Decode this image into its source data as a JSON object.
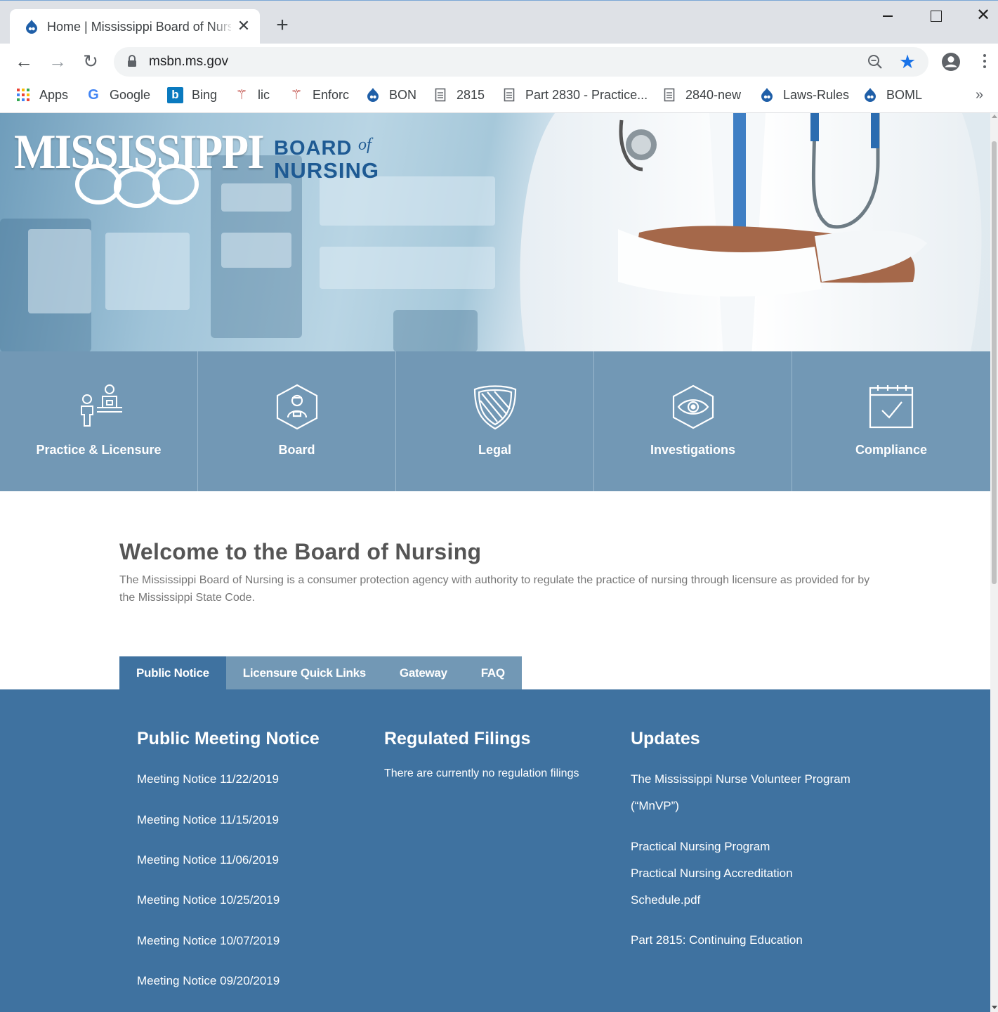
{
  "browser": {
    "tab_title": "Home | Mississippi Board of Nursing",
    "new_tab_label": "+",
    "url": "msbn.ms.gov",
    "bookmarks": [
      {
        "label": "Apps",
        "icon": "apps-grid-icon"
      },
      {
        "label": "Google",
        "icon": "google-icon"
      },
      {
        "label": "Bing",
        "icon": "bing-icon"
      },
      {
        "label": "lic",
        "icon": "caduceus-icon"
      },
      {
        "label": "Enforc",
        "icon": "caduceus-icon"
      },
      {
        "label": "BON",
        "icon": "drupal-icon"
      },
      {
        "label": "2815",
        "icon": "document-icon"
      },
      {
        "label": "Part 2830 - Practice...",
        "icon": "document-icon"
      },
      {
        "label": "2840-new",
        "icon": "document-icon"
      },
      {
        "label": "Laws-Rules",
        "icon": "drupal-icon"
      },
      {
        "label": "BOML",
        "icon": "drupal-icon"
      }
    ],
    "colors": {
      "accent": "#1a73e8",
      "chrome": "#dee1e6"
    }
  },
  "site": {
    "logo": {
      "main": "MISSISSIPPI",
      "board": "BOARD",
      "of": "of",
      "nursing": "NURSING"
    },
    "tiles": [
      {
        "label": "Practice & Licensure",
        "icon": "nurse-desk-icon"
      },
      {
        "label": "Board",
        "icon": "board-member-icon"
      },
      {
        "label": "Legal",
        "icon": "shield-icon"
      },
      {
        "label": "Investigations",
        "icon": "eye-icon"
      },
      {
        "label": "Compliance",
        "icon": "calendar-check-icon"
      }
    ],
    "welcome": {
      "title": "Welcome to the Board of Nursing",
      "body": "The Mississippi Board of Nursing is a consumer protection agency  with authority to regulate the practice of nursing through licensure as provided for by the Mississippi State Code."
    },
    "tabs": [
      "Public Notice",
      "Licensure Quick Links",
      "Gateway",
      "FAQ"
    ],
    "active_tab": "Public Notice",
    "public_meeting": {
      "title": "Public Meeting Notice",
      "items": [
        "Meeting Notice 11/22/2019",
        "Meeting Notice 11/15/2019",
        "Meeting Notice 11/06/2019",
        "Meeting Notice 10/25/2019",
        "Meeting Notice 10/07/2019",
        "Meeting Notice 09/20/2019"
      ]
    },
    "regulated_filings": {
      "title": "Regulated Filings",
      "text": "There are currently no regulation filings"
    },
    "updates": {
      "title": "Updates",
      "lines": [
        "The Mississippi Nurse Volunteer Program",
        "(“MnVP”)",
        "Practical Nursing Program",
        "Practical Nursing Accreditation",
        "Schedule.pdf",
        "Part 2815:  Continuing Education"
      ]
    },
    "colors": {
      "tile": "#7298b5",
      "panel": "#3f72a0",
      "logo_blue": "#1e5a93"
    }
  }
}
